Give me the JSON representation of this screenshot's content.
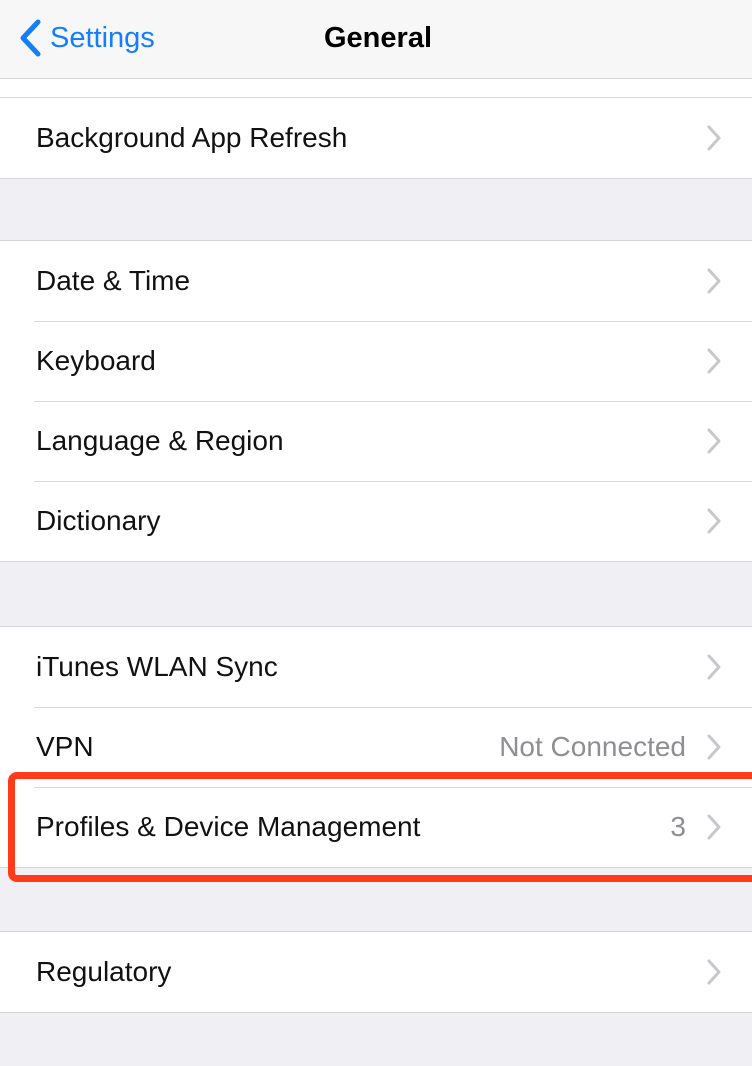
{
  "nav": {
    "back_label": "Settings",
    "title": "General"
  },
  "groups": [
    {
      "items": [
        {
          "label": "Background App Refresh",
          "detail": ""
        }
      ]
    },
    {
      "items": [
        {
          "label": "Date & Time",
          "detail": ""
        },
        {
          "label": "Keyboard",
          "detail": ""
        },
        {
          "label": "Language & Region",
          "detail": ""
        },
        {
          "label": "Dictionary",
          "detail": ""
        }
      ]
    },
    {
      "items": [
        {
          "label": "iTunes WLAN Sync",
          "detail": ""
        },
        {
          "label": "VPN",
          "detail": "Not Connected"
        },
        {
          "label": "Profiles & Device Management",
          "detail": "3"
        }
      ]
    },
    {
      "items": [
        {
          "label": "Regulatory",
          "detail": ""
        }
      ]
    }
  ],
  "colors": {
    "accent": "#157efb",
    "highlight": "#ff3b1a",
    "background": "#efeff4"
  },
  "icons": {
    "back": "chevron-left-icon",
    "disclosure": "chevron-right-icon"
  }
}
